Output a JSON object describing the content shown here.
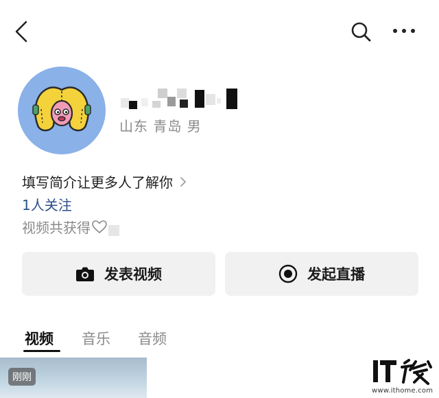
{
  "topbar": {
    "back_icon": "chevron-left-icon",
    "search_icon": "search-icon",
    "more_icon": "more-horizontal-icon"
  },
  "profile": {
    "avatar_icon": "cartoon-avatar",
    "location": "山东 青岛 男",
    "bio_prompt": "填写简介让更多人了解你",
    "following": "1人关注",
    "likes_label": "视频共获得"
  },
  "actions": {
    "publish_video": "发表视频",
    "go_live": "发起直播"
  },
  "tabs": [
    {
      "label": "视频",
      "active": true
    },
    {
      "label": "音乐",
      "active": false
    },
    {
      "label": "音频",
      "active": false
    }
  ],
  "videos": [
    {
      "badge": "刚刚"
    }
  ],
  "watermark": {
    "logo": "IT之家",
    "url": "www.ithome.com"
  },
  "colors": {
    "accent_link": "#2b4f8a",
    "muted_text": "#8a8a8a",
    "button_bg": "#f1f1f1",
    "avatar_bg": "#8ab1e8"
  }
}
